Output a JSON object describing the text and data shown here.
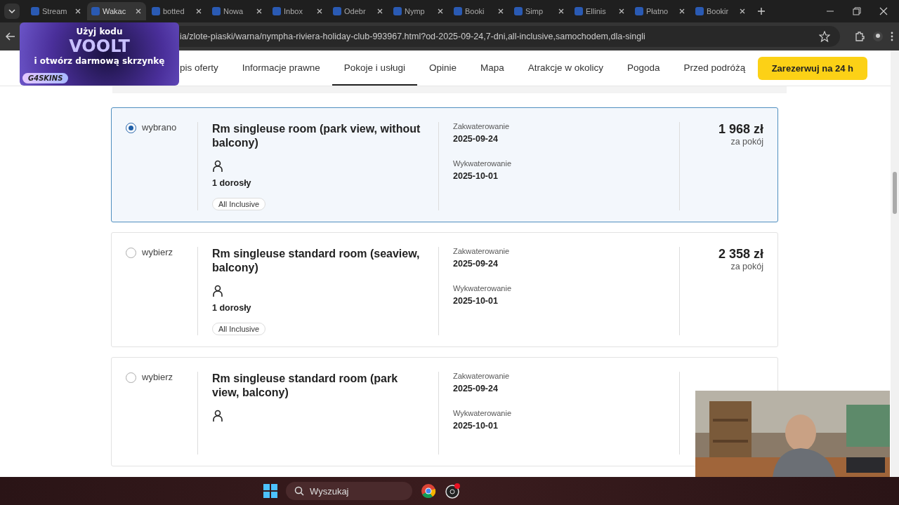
{
  "browser": {
    "tabs": [
      {
        "title": "Stream",
        "selected": false
      },
      {
        "title": "Wakac",
        "selected": true
      },
      {
        "title": "botted",
        "selected": false
      },
      {
        "title": "Nowa",
        "selected": false
      },
      {
        "title": "Inbox",
        "selected": false
      },
      {
        "title": "Odebr",
        "selected": false
      },
      {
        "title": "Nymp",
        "selected": false
      },
      {
        "title": "Booki",
        "selected": false
      },
      {
        "title": "Simp",
        "selected": false
      },
      {
        "title": "Ellinis",
        "selected": false
      },
      {
        "title": "Płatno",
        "selected": false
      },
      {
        "title": "Bookir",
        "selected": false
      }
    ],
    "url": "ia/zlote-piaski/warna/nympha-riviera-holiday-club-993967.html?od-2025-09-24,7-dni,all-inclusive,samochodem,dla-singli"
  },
  "nav": {
    "items": [
      {
        "label": "pis oferty",
        "selected": false
      },
      {
        "label": "Informacje prawne",
        "selected": false
      },
      {
        "label": "Pokoje i usługi",
        "selected": true
      },
      {
        "label": "Opinie",
        "selected": false
      },
      {
        "label": "Mapa",
        "selected": false
      },
      {
        "label": "Atrakcje w okolicy",
        "selected": false
      },
      {
        "label": "Pogoda",
        "selected": false
      },
      {
        "label": "Przed podróżą",
        "selected": false
      }
    ],
    "book_button": "Zarezerwuj na 24 h"
  },
  "rooms": [
    {
      "selected": true,
      "choice": "wybrano",
      "name": "Rm singleuse room (park view, without balcony)",
      "adults": "1 dorosły",
      "board": "All Inclusive",
      "checkin_label": "Zakwaterowanie",
      "checkin": "2025-09-24",
      "checkout_label": "Wykwaterowanie",
      "checkout": "2025-10-01",
      "price": "1 968 zł",
      "price_note": "za pokój"
    },
    {
      "selected": false,
      "choice": "wybierz",
      "name": "Rm singleuse standard room (seaview, balcony)",
      "adults": "1 dorosły",
      "board": "All Inclusive",
      "checkin_label": "Zakwaterowanie",
      "checkin": "2025-09-24",
      "checkout_label": "Wykwaterowanie",
      "checkout": "2025-10-01",
      "price": "2 358 zł",
      "price_note": "za pokój"
    },
    {
      "selected": false,
      "choice": "wybierz",
      "name": "Rm singleuse standard room (park view, balcony)",
      "checkin_label": "Zakwaterowanie",
      "checkin": "2025-09-24",
      "checkout_label": "Wykwaterowanie",
      "checkout": "2025-10-01"
    }
  ],
  "promo": {
    "line1": "Użyj kodu",
    "code": "VOOLT",
    "line2": "i otwórz darmową skrzynkę",
    "brand": "G4SKINS"
  },
  "taskbar": {
    "search_placeholder": "Wyszukaj"
  }
}
